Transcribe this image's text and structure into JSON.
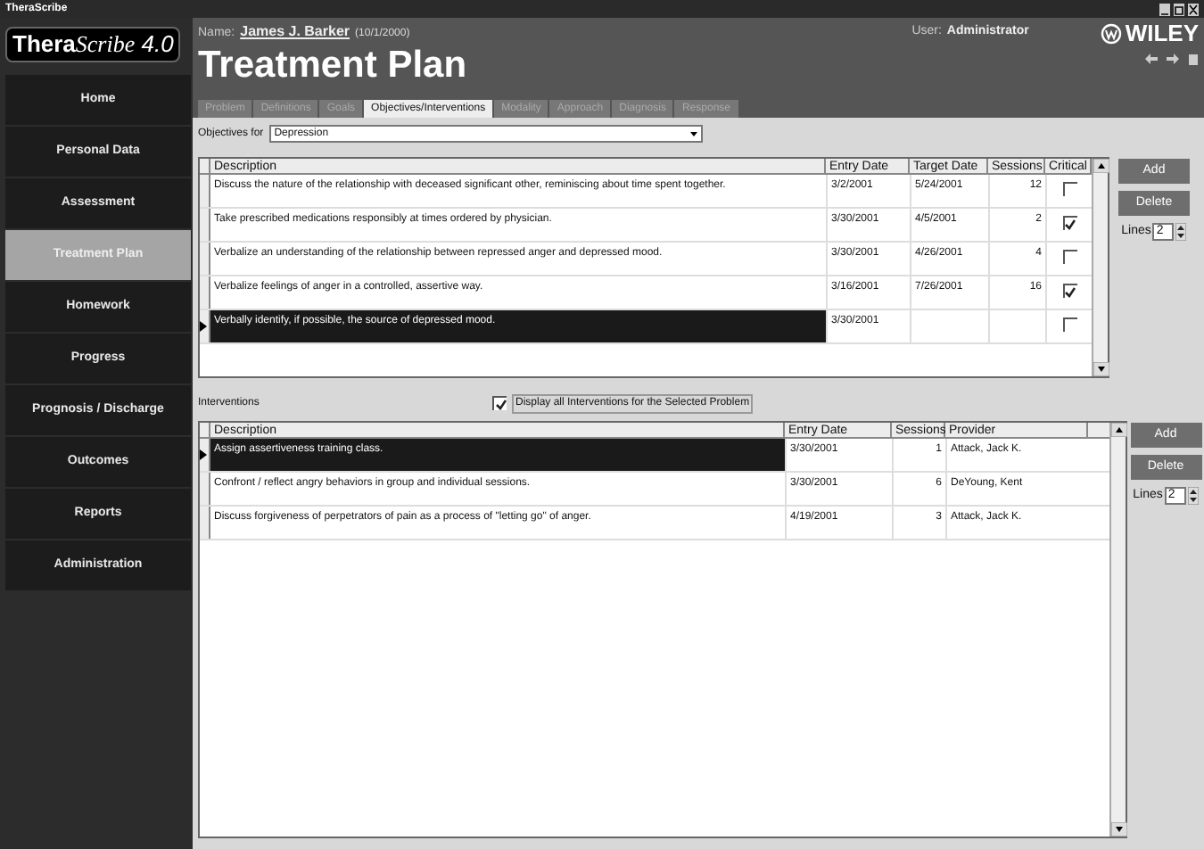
{
  "window": {
    "title": "TheraScribe"
  },
  "logo": {
    "brand": "Thera",
    "script": "Scribe",
    "version": "4.0"
  },
  "sidebar": {
    "items": [
      {
        "label": "Home",
        "selected": false
      },
      {
        "label": "Personal Data",
        "selected": false
      },
      {
        "label": "Assessment",
        "selected": false
      },
      {
        "label": "Treatment Plan",
        "selected": true
      },
      {
        "label": "Homework",
        "selected": false
      },
      {
        "label": "Progress",
        "selected": false
      },
      {
        "label": "Prognosis / Discharge",
        "selected": false
      },
      {
        "label": "Outcomes",
        "selected": false
      },
      {
        "label": "Reports",
        "selected": false
      },
      {
        "label": "Administration",
        "selected": false
      }
    ]
  },
  "header": {
    "name_label": "Name:",
    "patient": "James J. Barker",
    "dob": "(10/1/2000)",
    "user_label": "User:",
    "user": "Administrator",
    "title": "Treatment Plan",
    "publisher": "WILEY"
  },
  "tabs": [
    {
      "label": "Problem",
      "selected": false
    },
    {
      "label": "Definitions",
      "selected": false
    },
    {
      "label": "Goals",
      "selected": false
    },
    {
      "label": "Objectives/Interventions",
      "selected": true
    },
    {
      "label": "Modality",
      "selected": false
    },
    {
      "label": "Approach",
      "selected": false
    },
    {
      "label": "Diagnosis",
      "selected": false
    },
    {
      "label": "Response",
      "selected": false
    }
  ],
  "objectives_for": {
    "label": "Objectives for",
    "value": "Depression"
  },
  "objectives": {
    "columns": [
      "Description",
      "Entry Date",
      "Target Date",
      "Sessions",
      "Critical"
    ],
    "rows": [
      {
        "description": "Discuss the nature of the relationship with deceased significant other, reminiscing about time spent together.",
        "entry_date": "3/2/2001",
        "target_date": "5/24/2001",
        "sessions": "12",
        "critical": false,
        "selected": false
      },
      {
        "description": "Take prescribed medications responsibly at times ordered by physician.",
        "entry_date": "3/30/2001",
        "target_date": "4/5/2001",
        "sessions": "2",
        "critical": true,
        "selected": false
      },
      {
        "description": "Verbalize an understanding of the relationship between repressed anger and depressed mood.",
        "entry_date": "3/30/2001",
        "target_date": "4/26/2001",
        "sessions": "4",
        "critical": false,
        "selected": false
      },
      {
        "description": "Verbalize feelings of anger in a controlled, assertive way.",
        "entry_date": "3/16/2001",
        "target_date": "7/26/2001",
        "sessions": "16",
        "critical": true,
        "selected": false
      },
      {
        "description": "Verbally identify, if possible, the source of depressed mood.",
        "entry_date": "3/30/2001",
        "target_date": "",
        "sessions": "",
        "critical": false,
        "selected": true
      }
    ],
    "buttons": [
      "Add",
      "Delete"
    ],
    "lines_label": "Lines",
    "lines": "2"
  },
  "interventions": {
    "label": "Interventions",
    "display_all": {
      "label": "Display all Interventions for the Selected Problem",
      "checked": true
    },
    "columns": [
      "Description",
      "Entry Date",
      "Sessions",
      "Provider"
    ],
    "rows": [
      {
        "description": "Assign assertiveness training class.",
        "entry_date": "3/30/2001",
        "sessions": "1",
        "provider": "Attack, Jack K.",
        "selected": true
      },
      {
        "description": "Confront / reflect angry behaviors in group and individual sessions.",
        "entry_date": "3/30/2001",
        "sessions": "6",
        "provider": "DeYoung, Kent",
        "selected": false
      },
      {
        "description": "Discuss forgiveness of perpetrators of pain as a process of \"letting go\" of anger.",
        "entry_date": "4/19/2001",
        "sessions": "3",
        "provider": "Attack, Jack K.",
        "selected": false
      }
    ],
    "buttons": [
      "Add",
      "Delete"
    ],
    "lines_label": "Lines",
    "lines": "2"
  }
}
